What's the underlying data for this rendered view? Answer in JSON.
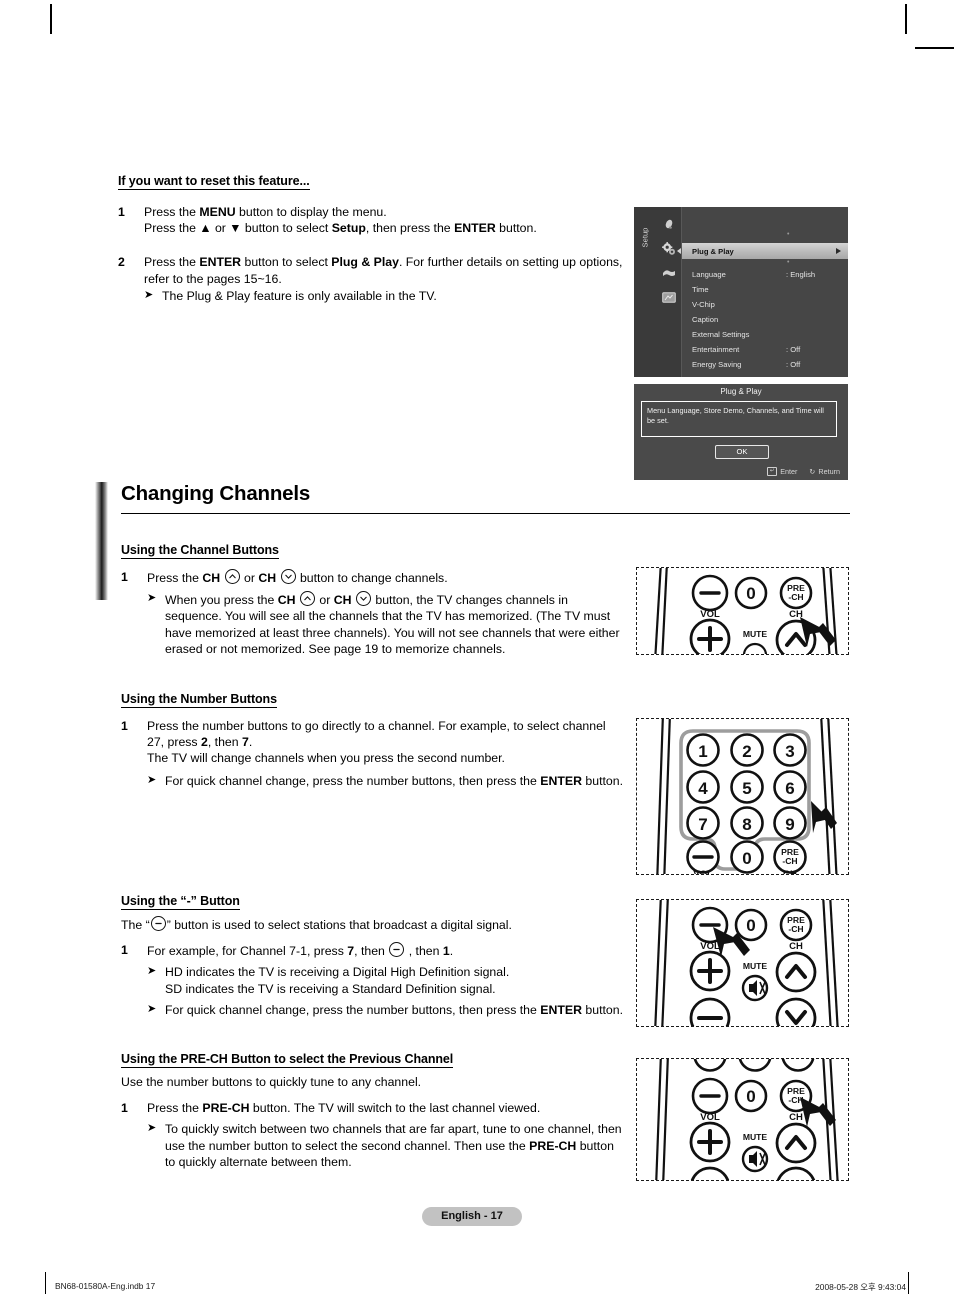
{
  "document": {
    "page_badge": "English - 17",
    "footer_left": "BN68-01580A-Eng.indb   17",
    "footer_right": "2008-05-28   오후 9:43:04"
  },
  "reset_section": {
    "heading": "If you want to reset this feature...",
    "steps": [
      {
        "num": "1",
        "line1_a": "Press the ",
        "line1_b": "MENU",
        "line1_c": " button to display the menu.",
        "line2_a": "Press the ▲ or ▼ button to select ",
        "line2_b": "Setup",
        "line2_c": ", then press the ",
        "line2_d": "ENTER",
        "line2_e": " button."
      },
      {
        "num": "2",
        "line1_a": "Press the ",
        "line1_b": "ENTER",
        "line1_c": " button to select ",
        "line1_d": "Plug & Play",
        "line1_e": ". For further details on setting up options, refer to the pages 15~16.",
        "note": "The Plug & Play feature is only available in the TV."
      }
    ]
  },
  "osd_menu": {
    "rail_label": "Setup",
    "icons": [
      "picture-icon",
      "setup-gear-icon",
      "sound-icon",
      "input-icon"
    ],
    "highlighted_item": "Plug & Play",
    "items": [
      {
        "label": "Language",
        "value": ": English"
      },
      {
        "label": "Time",
        "value": ""
      },
      {
        "label": "V-Chip",
        "value": ""
      },
      {
        "label": "Caption",
        "value": ""
      },
      {
        "label": "External Settings",
        "value": ""
      },
      {
        "label": "Entertainment",
        "value": ": Off"
      },
      {
        "label": "Energy Saving",
        "value": ": Off"
      }
    ]
  },
  "plug_play_dialog": {
    "title": "Plug & Play",
    "message": "Menu Language, Store Demo, Channels, and Time will be set.",
    "ok_label": "OK",
    "enter_label": "Enter",
    "return_label": "Return"
  },
  "changing_channels": {
    "title": "Changing Channels",
    "blocks": [
      {
        "heading": "Using the Channel Buttons",
        "step_num": "1",
        "step_a": "Press the ",
        "step_b": "CH",
        "step_c": " or ",
        "step_d": "CH",
        "step_e": " button to change channels.",
        "note_a": "When you press the ",
        "note_b": "CH",
        "note_c": " or ",
        "note_d": "CH",
        "note_e": " button, the TV changes channels in sequence. You will see all the channels that the TV has memorized. (The TV must have memorized at least three channels). You will not see channels that were either erased or not memorized. See page 19 to memorize channels."
      },
      {
        "heading": "Using the Number Buttons",
        "step_num": "1",
        "step_a": "Press the number buttons to go directly to a channel. For example, to select channel 27, press ",
        "step_b": "2",
        "step_c": ", then ",
        "step_d": "7",
        "step_e": ".",
        "step_line2": "The TV will change channels when you press the second number.",
        "note_a": "For quick channel change, press the number buttons, then press the ",
        "note_b": "ENTER",
        "note_c": " button."
      },
      {
        "heading": "Using the “-” Button",
        "intro_a": "The “",
        "intro_b": "” button is used to select stations that broadcast a digital signal.",
        "step_num": "1",
        "step_a": "For example, for Channel 7-1, press ",
        "step_b": "7",
        "step_c": ", then ",
        "step_d": " , then ",
        "step_e": "1",
        "step_f": ".",
        "note1_line1": "HD indicates the TV is receiving a Digital High Definition signal.",
        "note1_line2": "SD indicates the TV is receiving a Standard Definition signal.",
        "note2_a": "For quick channel change, press the number buttons, then press the ",
        "note2_b": "ENTER",
        "note2_c": " button."
      },
      {
        "heading": "Using the PRE-CH Button to select the Previous Channel",
        "intro": "Use the number buttons to quickly tune to any channel.",
        "step_num": "1",
        "step_a": "Press the ",
        "step_b": "PRE-CH",
        "step_c": " button. The TV will switch to the last channel viewed.",
        "note_a": "To quickly switch between two channels that are far apart, tune to one channel, then use the number button to select the second channel. Then use the ",
        "note_b": "PRE-CH",
        "note_c": " button to quickly alternate between them."
      }
    ]
  },
  "remote_illustrations": [
    {
      "name": "remote-channel-buttons",
      "buttons": [
        "−",
        "0",
        "PRE\n-CH",
        "VOL",
        "CH",
        "+",
        "MUTE",
        "^"
      ],
      "pointer_target": "CH up button"
    },
    {
      "name": "remote-number-buttons",
      "buttons": [
        "1",
        "2",
        "3",
        "4",
        "5",
        "6",
        "7",
        "8",
        "9",
        "−",
        "0",
        "PRE -CH"
      ],
      "pointer_target": "number keypad"
    },
    {
      "name": "remote-dash-button",
      "buttons": [
        "−",
        "0",
        "PRE -CH",
        "VOL",
        "CH",
        "+",
        "MUTE",
        "^",
        "−",
        "v"
      ],
      "pointer_target": "minus (dash) button"
    },
    {
      "name": "remote-pre-ch-button",
      "buttons": [
        "−",
        "0",
        "PRE -CH",
        "VOL",
        "CH",
        "+",
        "MUTE",
        "^"
      ],
      "pointer_target": "PRE-CH button"
    }
  ],
  "labels": {
    "vol": "VOL",
    "ch": "CH",
    "mute": "MUTE",
    "pre": "PRE",
    "pre2": "-CH",
    "zero": "0",
    "keys": [
      "1",
      "2",
      "3",
      "4",
      "5",
      "6",
      "7",
      "8",
      "9"
    ]
  }
}
